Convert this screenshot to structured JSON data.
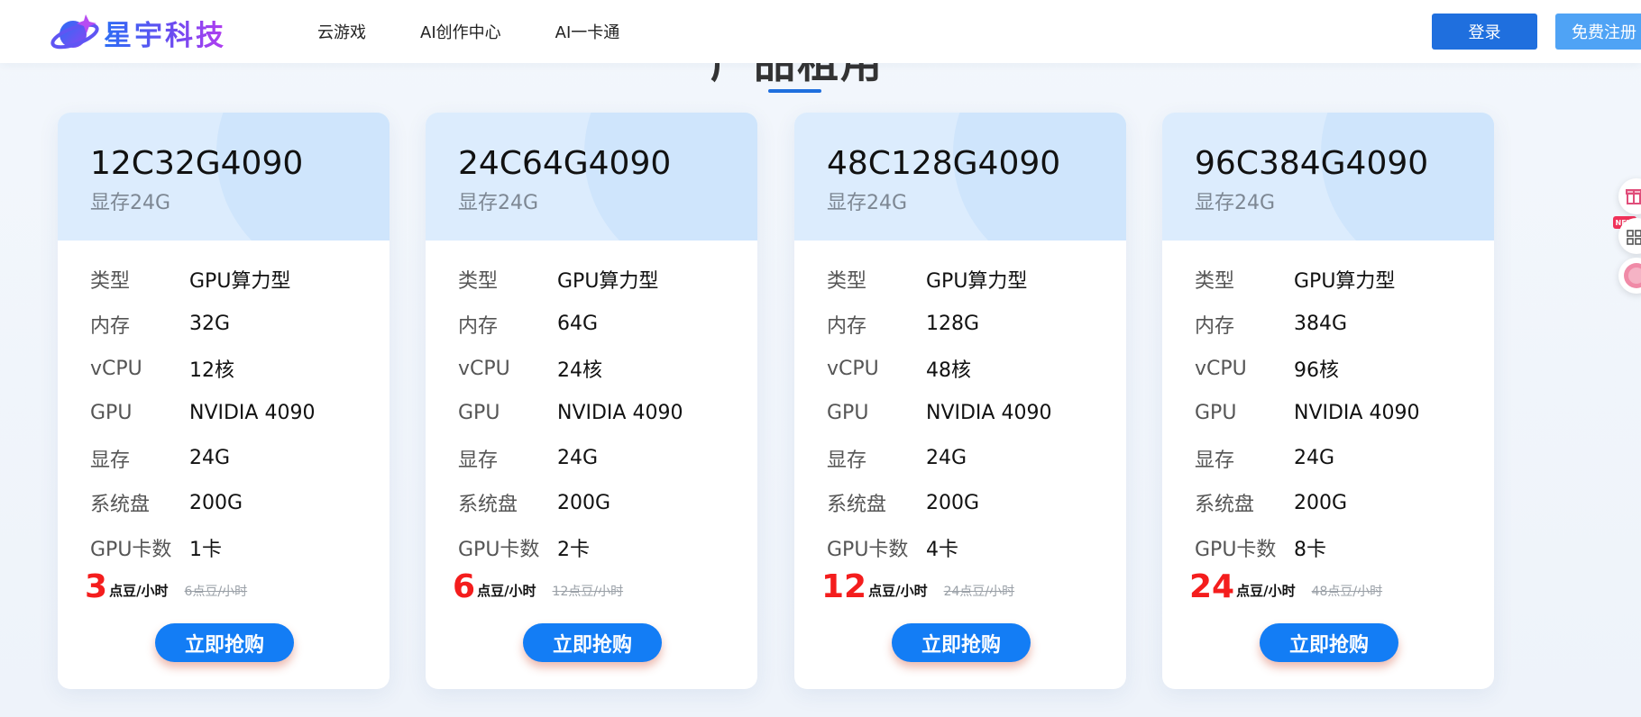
{
  "header": {
    "brand": "星宇科技",
    "nav": [
      "云游戏",
      "AI创作中心",
      "AI一卡通"
    ],
    "login_label": "登录",
    "register_label": "免费注册"
  },
  "section": {
    "title": "产品租用"
  },
  "cards": [
    {
      "name": "12C32G4090",
      "subtitle": "显存24G",
      "specs": [
        {
          "label": "类型",
          "value": "GPU算力型"
        },
        {
          "label": "内存",
          "value": "32G"
        },
        {
          "label": "vCPU",
          "value": "12核"
        },
        {
          "label": "GPU",
          "value": "NVIDIA 4090"
        },
        {
          "label": "显存",
          "value": "24G"
        },
        {
          "label": "系统盘",
          "value": "200G"
        },
        {
          "label": "GPU卡数",
          "value": "1卡"
        }
      ],
      "price": "3",
      "price_unit": "点豆/小时",
      "original_price": "6点豆/小时",
      "buy_label": "立即抢购"
    },
    {
      "name": "24C64G4090",
      "subtitle": "显存24G",
      "specs": [
        {
          "label": "类型",
          "value": "GPU算力型"
        },
        {
          "label": "内存",
          "value": "64G"
        },
        {
          "label": "vCPU",
          "value": "24核"
        },
        {
          "label": "GPU",
          "value": "NVIDIA 4090"
        },
        {
          "label": "显存",
          "value": "24G"
        },
        {
          "label": "系统盘",
          "value": "200G"
        },
        {
          "label": "GPU卡数",
          "value": "2卡"
        }
      ],
      "price": "6",
      "price_unit": "点豆/小时",
      "original_price": "12点豆/小时",
      "buy_label": "立即抢购"
    },
    {
      "name": "48C128G4090",
      "subtitle": "显存24G",
      "specs": [
        {
          "label": "类型",
          "value": "GPU算力型"
        },
        {
          "label": "内存",
          "value": "128G"
        },
        {
          "label": "vCPU",
          "value": "48核"
        },
        {
          "label": "GPU",
          "value": "NVIDIA 4090"
        },
        {
          "label": "显存",
          "value": "24G"
        },
        {
          "label": "系统盘",
          "value": "200G"
        },
        {
          "label": "GPU卡数",
          "value": "4卡"
        }
      ],
      "price": "12",
      "price_unit": "点豆/小时",
      "original_price": "24点豆/小时",
      "buy_label": "立即抢购"
    },
    {
      "name": "96C384G4090",
      "subtitle": "显存24G",
      "specs": [
        {
          "label": "类型",
          "value": "GPU算力型"
        },
        {
          "label": "内存",
          "value": "384G"
        },
        {
          "label": "vCPU",
          "value": "96核"
        },
        {
          "label": "GPU",
          "value": "NVIDIA 4090"
        },
        {
          "label": "显存",
          "value": "24G"
        },
        {
          "label": "系统盘",
          "value": "200G"
        },
        {
          "label": "GPU卡数",
          "value": "8卡"
        }
      ],
      "price": "24",
      "price_unit": "点豆/小时",
      "original_price": "48点豆/小时",
      "buy_label": "立即抢购"
    }
  ],
  "float_tools": {
    "new_badge": "NEW",
    "icons": [
      "gift-icon",
      "grid-icon",
      "chat-icon"
    ]
  },
  "colors": {
    "primary": "#1f6fde",
    "register": "#4fa3f5",
    "price": "#f41d1d",
    "buy_button": "#137df5",
    "card_header": "#dcecfd"
  }
}
